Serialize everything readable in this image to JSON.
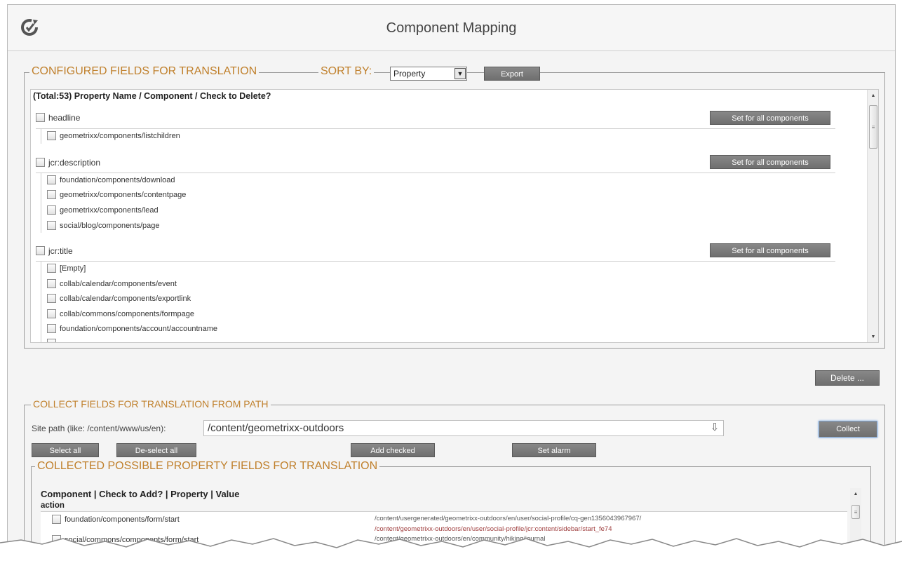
{
  "window": {
    "title": "Component Mapping"
  },
  "configured": {
    "legend": "CONFIGURED FIELDS FOR TRANSLATION",
    "sort_label": "SORT BY:",
    "sort_value": "Property",
    "export_label": "Export",
    "header": "(Total:53) Property Name / Component / Check to Delete?",
    "set_all_label": "Set for all components",
    "groups": [
      {
        "name": "headline",
        "items": [
          "geometrixx/components/listchildren"
        ]
      },
      {
        "name": "jcr:description",
        "items": [
          "foundation/components/download",
          "geometrixx/components/contentpage",
          "geometrixx/components/lead",
          "social/blog/components/page"
        ]
      },
      {
        "name": "jcr:title",
        "items": [
          "[Empty]",
          "collab/calendar/components/event",
          "collab/calendar/components/exportlink",
          "collab/commons/components/formpage",
          "foundation/components/account/accountname"
        ]
      }
    ],
    "delete_label": "Delete ..."
  },
  "collect": {
    "legend": "COLLECT FIELDS FOR TRANSLATION FROM PATH",
    "site_path_label": "Site path (like: /content/www/us/en):",
    "site_path_value": "/content/geometrixx-outdoors",
    "collect_label": "Collect",
    "select_all_label": "Select all",
    "deselect_all_label": "De-select all",
    "add_checked_label": "Add checked",
    "set_alarm_label": "Set alarm"
  },
  "collected": {
    "legend": "COLLECTED POSSIBLE PROPERTY FIELDS FOR TRANSLATION",
    "header": "Component | Check to Add? | Property | Value",
    "property": "action",
    "rows": [
      {
        "component": "foundation/components/form/start",
        "paths": [
          "/content/usergenerated/geometrixx-outdoors/en/user/social-profile/cq-gen1356043967967/",
          "/content/geometrixx-outdoors/en/user/social-profile/jcr:content/sidebar/start_fe74"
        ]
      },
      {
        "component": "social/commons/components/form/start",
        "paths": [
          "/content/geometrixx-outdoors/en/community/hiking/journal"
        ]
      }
    ]
  },
  "colors": {
    "legend": "#c0802c",
    "button": "#7a7a7a",
    "path_link": "#a04040"
  }
}
